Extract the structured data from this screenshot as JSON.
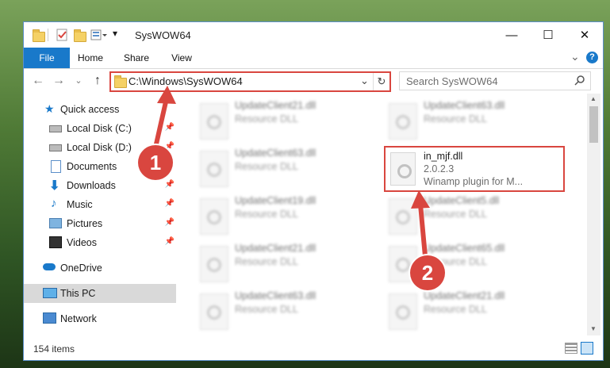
{
  "window": {
    "title": "SysWOW64",
    "minimize": "—",
    "maximize": "☐",
    "close": "✕"
  },
  "ribbon": {
    "tabs": [
      "File",
      "Home",
      "Share",
      "View"
    ],
    "collapse": "⌄",
    "help": "?"
  },
  "nav": {
    "back": "←",
    "forward": "→",
    "recent": "⌄",
    "up": "↑",
    "address": "C:\\Windows\\SysWOW64",
    "address_dropdown": "⌄",
    "refresh": "↻",
    "search_placeholder": "Search SysWOW64",
    "search_icon": "search-icon"
  },
  "sidebar": {
    "items": [
      {
        "label": "Quick access",
        "icon": "star-icon"
      },
      {
        "label": "Local Disk (C:)",
        "icon": "drive-icon",
        "pinned": true
      },
      {
        "label": "Local Disk (D:)",
        "icon": "drive-icon",
        "pinned": true
      },
      {
        "label": "Documents",
        "icon": "documents-icon",
        "pinned": true
      },
      {
        "label": "Downloads",
        "icon": "downloads-icon",
        "pinned": true
      },
      {
        "label": "Music",
        "icon": "music-icon",
        "pinned": true
      },
      {
        "label": "Pictures",
        "icon": "pictures-icon",
        "pinned": true
      },
      {
        "label": "Videos",
        "icon": "videos-icon",
        "pinned": true
      },
      {
        "label": "OneDrive",
        "icon": "cloud-icon"
      },
      {
        "label": "This PC",
        "icon": "pc-icon",
        "selected": true
      },
      {
        "label": "Network",
        "icon": "network-icon"
      }
    ]
  },
  "files": [
    {
      "name": "UpdateClient21.dll",
      "type": "Resource DLL"
    },
    {
      "name": "UpdateClient63.dll",
      "type": "Resource DLL"
    },
    {
      "name": "UpdateClient63.dll",
      "type": "Resource DLL"
    },
    {
      "name": "UpdateClient19.dll",
      "type": "Resource DLL"
    },
    {
      "name": "UpdateClient5.dll",
      "type": "Resource DLL"
    },
    {
      "name": "UpdateClient21.dll",
      "type": "Resource DLL"
    },
    {
      "name": "UpdateClient65.dll",
      "type": "Resource DLL"
    },
    {
      "name": "UpdateClient63.dll",
      "type": "Resource DLL"
    },
    {
      "name": "UpdateClient21.dll",
      "type": "Resource DLL"
    }
  ],
  "selected_file": {
    "name": "in_mjf.dll",
    "version": "2.0.2.3",
    "description": "Winamp plugin for M..."
  },
  "status": {
    "items_count": "154 items"
  },
  "callouts": [
    "1",
    "2"
  ],
  "colors": {
    "accent": "#1979ca",
    "highlight": "#d9463f"
  }
}
